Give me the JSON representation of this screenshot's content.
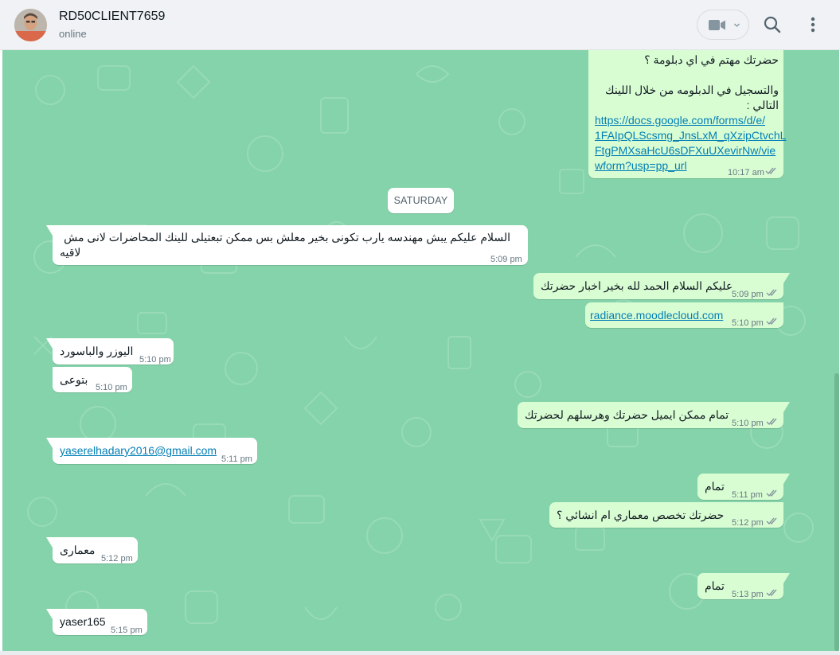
{
  "header": {
    "contact_name": "RD50CLIENT7659",
    "status": "online",
    "icons": [
      "video-camera-icon",
      "chevron-down-icon",
      "search-icon",
      "more-vertical-icon"
    ]
  },
  "colors": {
    "chat_background": "#84d3aa",
    "incoming_bubble": "#ffffff",
    "outgoing_bubble": "#d9fdd3",
    "link": "#027eb5",
    "read_ticks": "#8696a0"
  },
  "date_separator": "SATURDAY",
  "messages": [
    {
      "direction": "out",
      "lines": [
        "حضرتك مهتم في اي دبلومة ؟",
        "",
        "والتسجيل في الدبلومه من خلال اللينك",
        "التالي :"
      ],
      "link_lines": [
        "https://docs.google.com/forms/d/e/",
        "1FAIpQLScsmg_JnsLxM_qXzipCtvchL",
        "FtgPMXsaHcU6sDFXuUXevirNw/vie",
        "wform?usp=pp_url"
      ],
      "time": "10:17 am",
      "status": "read"
    },
    {
      "direction": "in",
      "lines": [
        "السلام عليكم يبش مهندسه يارب تكونى بخير معلش بس ممكن تبعتيلى للينك المحاضرات  لانى مش",
        "لاقيه"
      ],
      "time": "5:09 pm"
    },
    {
      "direction": "out",
      "text": "عليكم السلام الحمد لله بخير اخبار حضرتك",
      "time": "5:09 pm",
      "status": "read"
    },
    {
      "direction": "out",
      "text": "radiance.moodlecloud.com",
      "is_link": true,
      "time": "5:10 pm",
      "status": "read"
    },
    {
      "direction": "in",
      "text": "اليوزر والباسورد",
      "time": "5:10 pm"
    },
    {
      "direction": "in",
      "text": "بتوعى",
      "time": "5:10 pm"
    },
    {
      "direction": "out",
      "text": "تمام ممكن ايميل حضرتك وهرسلهم لحضرتك",
      "time": "5:10 pm",
      "status": "read"
    },
    {
      "direction": "in",
      "text": "yaserelhadary2016@gmail.com",
      "is_link": true,
      "time": "5:11 pm"
    },
    {
      "direction": "out",
      "text": "تمام",
      "time": "5:11 pm",
      "status": "read"
    },
    {
      "direction": "out",
      "text": "حضرتك تخصص معماري ام انشائي ؟",
      "time": "5:12 pm",
      "status": "read"
    },
    {
      "direction": "in",
      "text": "معمارى",
      "time": "5:12 pm"
    },
    {
      "direction": "out",
      "text": "تمام",
      "time": "5:13 pm",
      "status": "read"
    },
    {
      "direction": "in",
      "text": "yaser165",
      "time": "5:15 pm"
    }
  ]
}
